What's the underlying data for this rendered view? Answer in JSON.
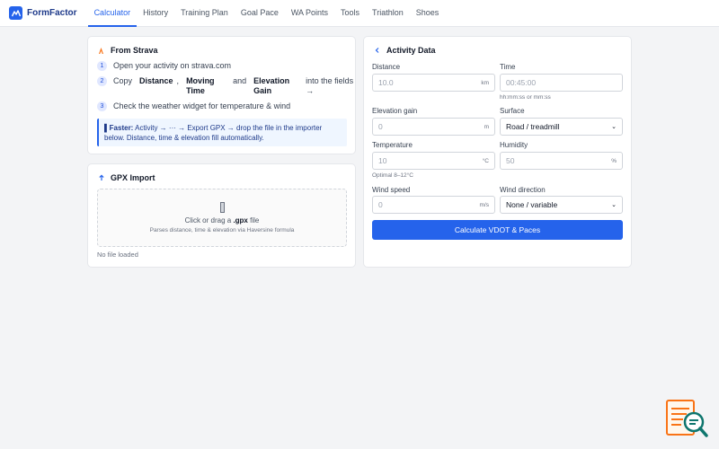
{
  "app": {
    "name": "FormFactor"
  },
  "nav": [
    {
      "label": "Calculator",
      "active": true
    },
    {
      "label": "History"
    },
    {
      "label": "Training Plan"
    },
    {
      "label": "Goal Pace"
    },
    {
      "label": "WA Points"
    },
    {
      "label": "Tools"
    },
    {
      "label": "Triathlon"
    },
    {
      "label": "Shoes"
    }
  ],
  "strava": {
    "title": "From Strava",
    "icon": "strava-icon",
    "steps": [
      {
        "num": "1",
        "text": "Open your activity on strava.com"
      },
      {
        "num": "2",
        "pre": "Copy",
        "b1": "Distance",
        "comma": ",",
        "b2": "Moving Time",
        "and": "and",
        "b3": "Elevation Gain",
        "post": "into the fields →"
      },
      {
        "num": "3",
        "text": "Check the weather widget for temperature & wind"
      }
    ],
    "tip_bold": "▌Faster:",
    "tip_text": "Activity → ··· → Export GPX → drop the file in the importer below. Distance, time & elevation fill automatically."
  },
  "gpx": {
    "title": "GPX Import",
    "icon": "upload-icon",
    "drop_pre": "Click or drag a",
    "drop_bold": ".gpx",
    "drop_post": "file",
    "drop_sub": "Parses distance, time & elevation via Haversine formula",
    "status": "No file loaded"
  },
  "activity": {
    "title": "Activity Data",
    "icon": "chevron-left-icon",
    "distance": {
      "label": "Distance",
      "placeholder": "10.0",
      "unit": "km"
    },
    "time": {
      "label": "Time",
      "placeholder": "00:45:00",
      "hint": "hh:mm:ss or mm:ss"
    },
    "elevation": {
      "label": "Elevation gain",
      "placeholder": "0",
      "unit": "m"
    },
    "surface": {
      "label": "Surface",
      "value": "Road / treadmill"
    },
    "temperature": {
      "label": "Temperature",
      "placeholder": "10",
      "unit": "°C",
      "hint": "Optimal 8–12°C"
    },
    "humidity": {
      "label": "Humidity",
      "placeholder": "50",
      "unit": "%"
    },
    "wind_speed": {
      "label": "Wind speed",
      "placeholder": "0",
      "unit": "m/s"
    },
    "wind_direction": {
      "label": "Wind direction",
      "value": "None / variable"
    },
    "button": "Calculate VDOT & Paces"
  },
  "colors": {
    "accent": "#2563eb",
    "strava": "#f97316",
    "widget": "#f97316",
    "widget_lens": "#0f766e"
  }
}
